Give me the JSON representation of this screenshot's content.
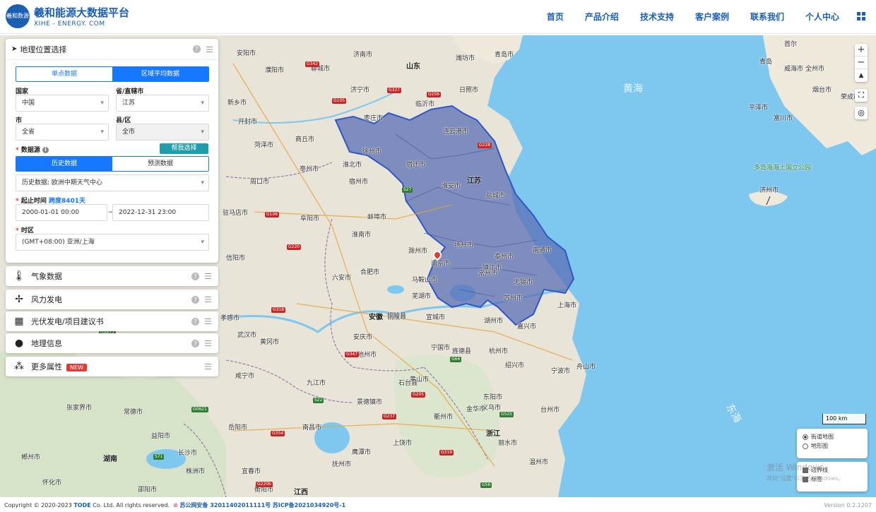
{
  "header": {
    "logo_badge": "羲和数源",
    "title": "羲和能源大数据平台",
    "subtitle": "XIHE - ENERGY. COM",
    "nav": [
      "首页",
      "产品介绍",
      "技术支持",
      "客户案例",
      "联系我们",
      "个人中心"
    ]
  },
  "panel": {
    "title": "地理位置选择",
    "tabs": [
      "单点数据",
      "区域平均数据"
    ],
    "country_label": "国家",
    "country_value": "中国",
    "province_label": "省/直辖市",
    "province_value": "江苏",
    "city_label": "市",
    "city_value": "全省",
    "county_label": "县/区",
    "county_value": "全市",
    "source_label": "数据源",
    "help_button": "帮我选择",
    "source_tabs": [
      "历史数据",
      "预测数据"
    ],
    "source_value": "历史数据: 欧洲中期天气中心",
    "time_label": "起止时间",
    "span_text": "跨度8401天",
    "start_time": "2000-01-01 00:00",
    "tilde": "~",
    "end_time": "2022-12-31 23:00",
    "tz_label": "时区",
    "tz_value": "(GMT+08:00) 亚洲/上海"
  },
  "side_items": [
    {
      "label": "气象数据",
      "icon": "thermometer-icon"
    },
    {
      "label": "风力发电",
      "icon": "wind-turbine-icon"
    },
    {
      "label": "光伏发电/项目建议书",
      "icon": "solar-panel-icon"
    },
    {
      "label": "地理信息",
      "icon": "globe-icon"
    },
    {
      "label": "更多属性",
      "icon": "dots-icon",
      "badge": "NEW"
    }
  ],
  "map": {
    "sea_labels": [
      "黄海",
      "东海"
    ],
    "province_labels": [
      "山东",
      "江苏",
      "安徽",
      "浙江",
      "湖南",
      "江西"
    ],
    "cities": [
      "安阳市",
      "濮阳市",
      "新乡市",
      "开封市",
      "商丘市",
      "周口市",
      "驻马店市",
      "信阳市",
      "孝感市",
      "武汉市",
      "黄冈市",
      "咸宁市",
      "岳阳市",
      "长沙市",
      "株洲市",
      "益阳市",
      "常德市",
      "宜春市",
      "南昌市",
      "九江市",
      "景德镇市",
      "上饶市",
      "抚州市",
      "鹰潭市",
      "黄山市",
      "安庆市",
      "池州市",
      "铜陵市",
      "合肥市",
      "六安市",
      "淮南市",
      "蚌埠市",
      "阜阳市",
      "亳州市",
      "宿州市",
      "淮北市",
      "徐州市",
      "宿迁市",
      "淮安市",
      "连云港市",
      "盐城市",
      "扬州市",
      "泰州市",
      "南通市",
      "镇江市",
      "南京市",
      "常州市",
      "无锡市",
      "苏州市",
      "上海市",
      "嘉兴市",
      "湖州市",
      "杭州市",
      "绍兴市",
      "宁波市",
      "舟山市",
      "金华市",
      "衢州市",
      "丽水市",
      "温州市",
      "台州市",
      "临沂市",
      "日照市",
      "青岛市",
      "潍坊市",
      "济南市",
      "聊城市",
      "菏泽市",
      "济宁市",
      "枣庄市",
      "滁州市",
      "马鞍山市",
      "芜湖市",
      "宣城市",
      "宁国市",
      "铜陵县",
      "石台县",
      "旌德县",
      "东阳市",
      "义乌市",
      "青岛",
      "威海市",
      "烟台市",
      "荣成市",
      "全州市",
      "济州市",
      "首尔",
      "富川市",
      "平泽市",
      "张家界市",
      "怀化市",
      "邵阳市",
      "衡阳市",
      "郴州市"
    ],
    "roads": [
      "G342",
      "G105",
      "G327",
      "G206",
      "G228",
      "G106",
      "G220",
      "G318",
      "G347",
      "G205",
      "G237",
      "G354",
      "G220b",
      "G319",
      "S22",
      "S71",
      "G525",
      "S27",
      "G66",
      "G56",
      "G0621",
      "G0612"
    ],
    "park_label": "多岛海海上国立公园",
    "scale_label": "100 km",
    "layers": [
      "街道地图",
      "地形图"
    ],
    "overlays": [
      "边界线",
      "标签"
    ]
  },
  "watermark": {
    "line1": "激活 Windows",
    "line2": "转到\"设置\"以激活 Windows。"
  },
  "footer": {
    "copyright": "Copyright © 2020-2023 ",
    "company": "TODE",
    "rest": " Co. Ltd. All rights reserved.",
    "beian": "苏公网安备 32011402011111号 苏ICP备2021034920号-1",
    "version": "Version 0.2.1207"
  }
}
